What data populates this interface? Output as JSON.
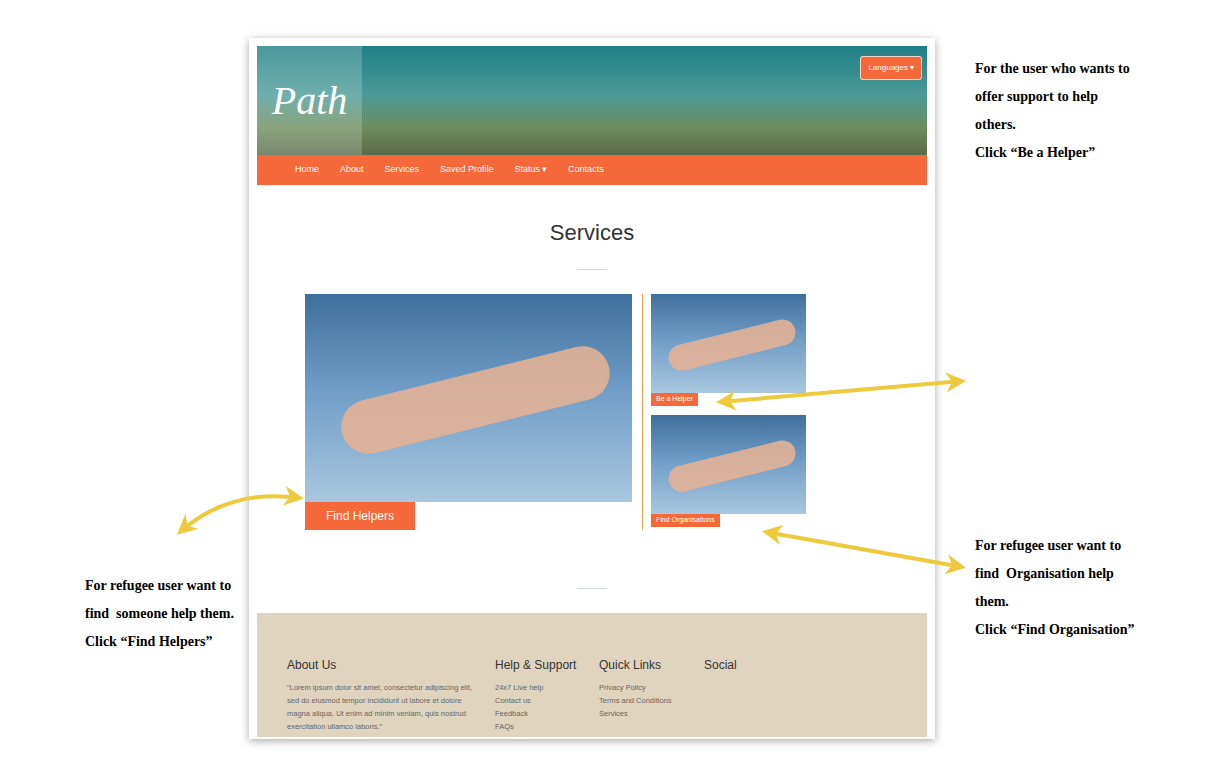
{
  "header": {
    "logo": "Path",
    "languages_button": {
      "label": "Languages",
      "caret": "▾"
    }
  },
  "nav": [
    {
      "label": "Home",
      "caret": ""
    },
    {
      "label": "About",
      "caret": ""
    },
    {
      "label": "Services",
      "caret": ""
    },
    {
      "label": "Saved Profile",
      "caret": ""
    },
    {
      "label": "Status",
      "caret": "▾"
    },
    {
      "label": "Contacts",
      "caret": ""
    }
  ],
  "page": {
    "title": "Services"
  },
  "services": {
    "main": {
      "button": "Find Helpers"
    },
    "side": [
      {
        "button": "Be a Helper"
      },
      {
        "button": "Find Organisations"
      }
    ]
  },
  "footer": {
    "columns": [
      {
        "title": "About Us",
        "lines": [
          "“Lorem ipsum dolor sit amet, consectetur adipiscing elit,",
          "sed do eiusmod tempor incididunt ut labore et dolore",
          "magna aliqua. Ut enim ad minim veniam, quis nostrud",
          "exercitation ullamco laboris.”"
        ]
      },
      {
        "title": "Help & Support",
        "lines": [
          "24x7 Live help",
          "Contact us",
          "Feedback",
          "FAQs"
        ]
      },
      {
        "title": "Quick Links",
        "lines": [
          "Privacy Policy",
          "Terms and Conditions",
          "Services"
        ]
      },
      {
        "title": "Social",
        "lines": []
      }
    ]
  },
  "annotations": [
    {
      "lines": [
        "For the user who wants to",
        "offer support to help",
        "others.",
        "Click “Be a Helper”"
      ]
    },
    {
      "lines": [
        "For refugee user want to",
        "find  Organisation help",
        "them.",
        "Click “Find Organisation”"
      ]
    },
    {
      "lines": [
        "For refugee user want to",
        "find  someone help them.",
        "Click “Find Helpers”"
      ]
    }
  ]
}
